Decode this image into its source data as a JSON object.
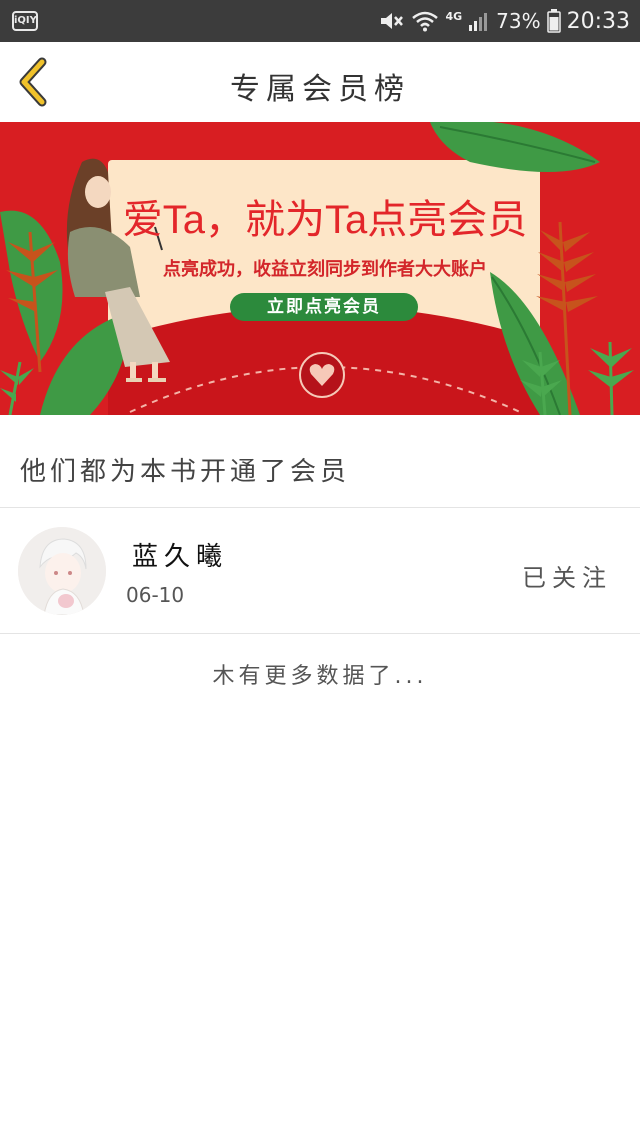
{
  "status_bar": {
    "app_icon_label": "iQIY",
    "network": "4G",
    "battery": "73%",
    "time": "20:33"
  },
  "header": {
    "title": "专属会员榜",
    "back_icon": "chevron-left-icon",
    "accent_color": "#f0c22b"
  },
  "banner": {
    "headline": "爱Ta，就为Ta点亮会员",
    "subline": "点亮成功，收益立刻同步到作者大大账户",
    "cta": "立即点亮会员",
    "primary_color": "#d81e22",
    "card_color": "#fde6c8",
    "leaf_color": "#3f9a45"
  },
  "section": {
    "title": "他们都为本书开通了会员"
  },
  "members": [
    {
      "name": "蓝久曦",
      "date": "06-10",
      "status": "已关注"
    }
  ],
  "end_note": "木有更多数据了..."
}
